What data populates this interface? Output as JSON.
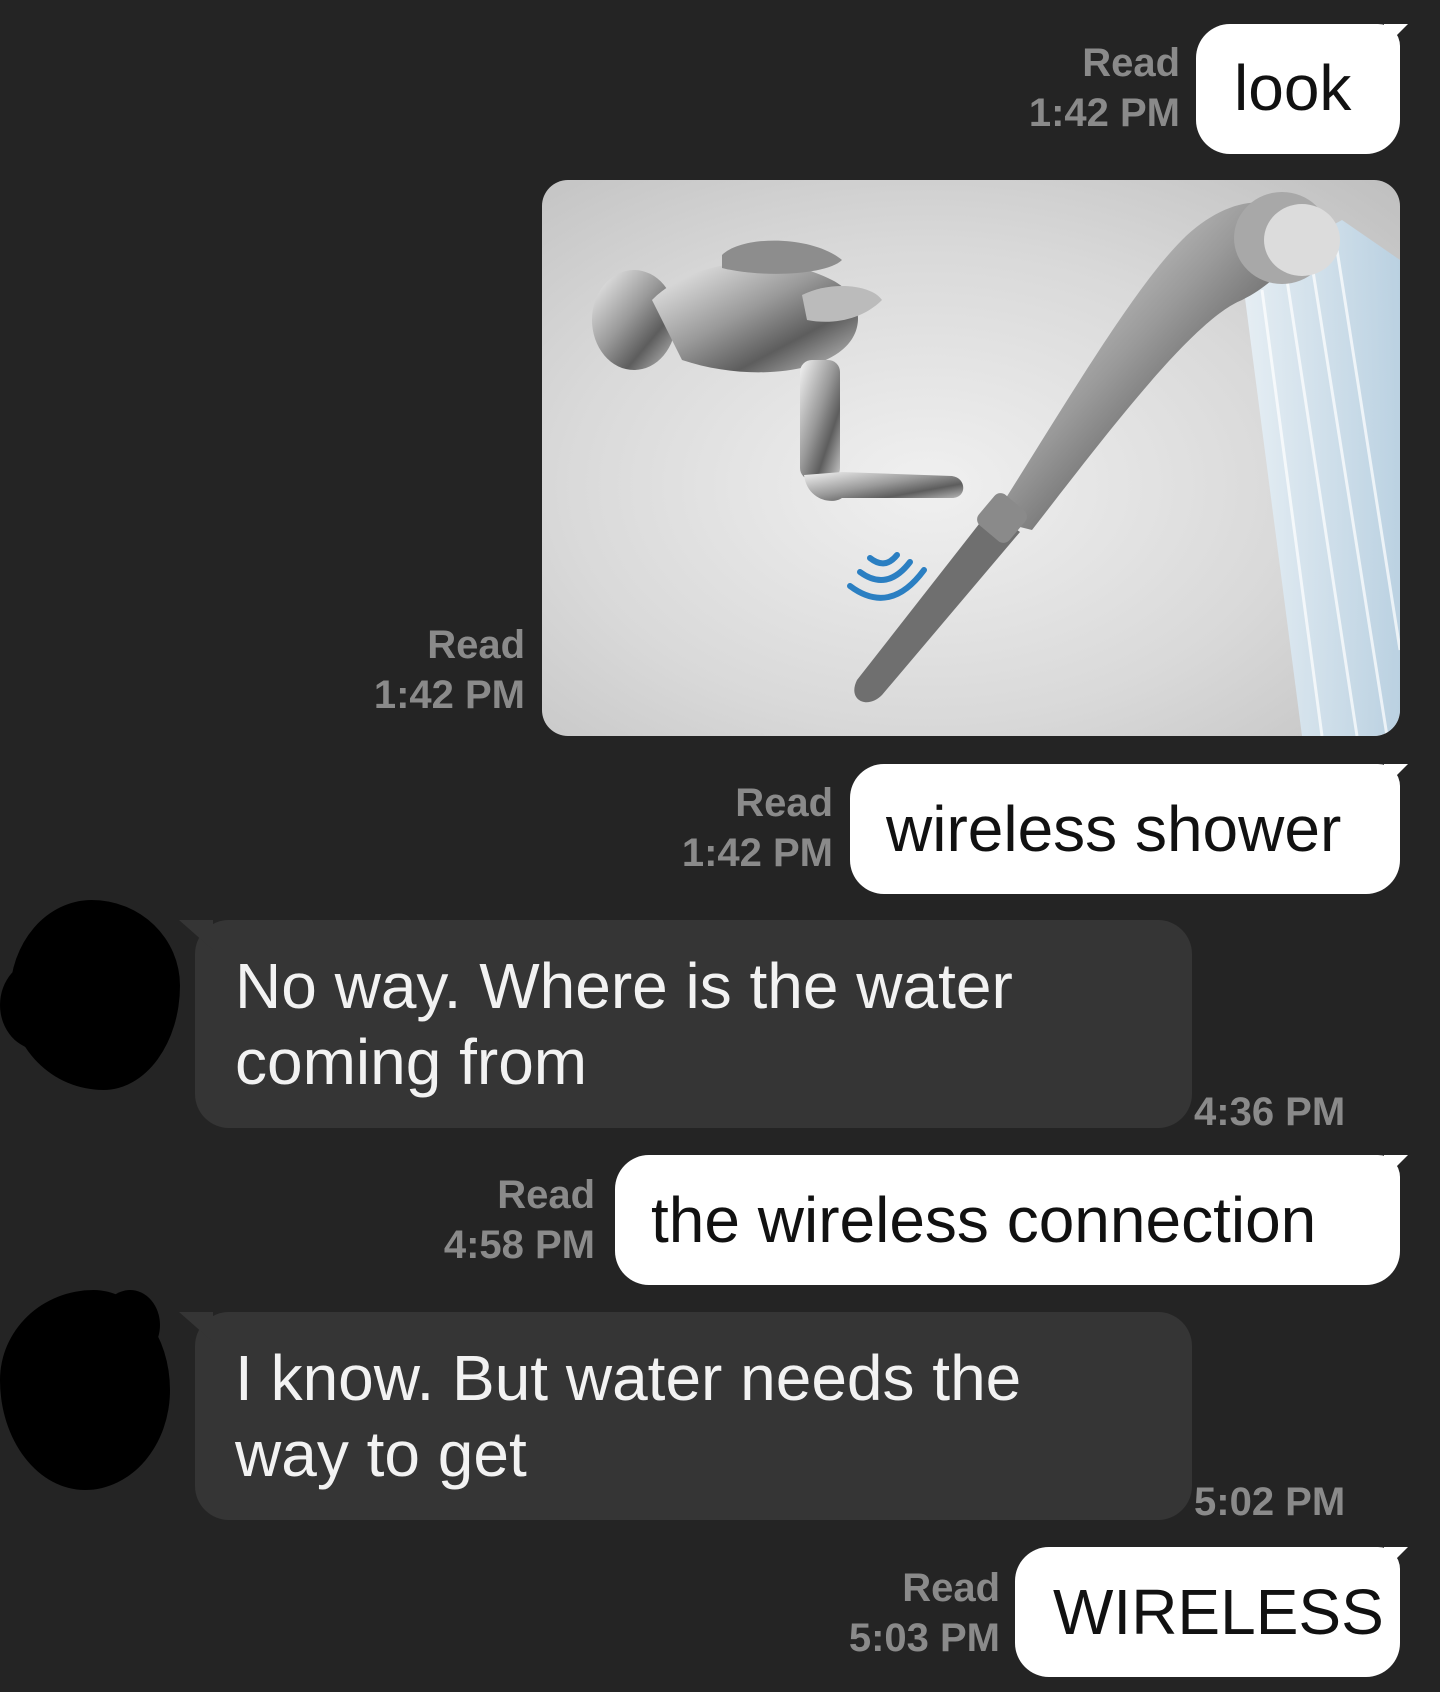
{
  "messages": [
    {
      "direction": "out",
      "text": "look",
      "status": "Read",
      "time": "1:42 PM"
    },
    {
      "direction": "out",
      "type": "image",
      "image_icon": "wireless-shower-photo",
      "status": "Read",
      "time": "1:42 PM"
    },
    {
      "direction": "out",
      "text": "wireless shower",
      "status": "Read",
      "time": "1:42 PM"
    },
    {
      "direction": "in",
      "lines": [
        "No way. Where is the water",
        "coming from"
      ],
      "time": "4:36 PM"
    },
    {
      "direction": "out",
      "text": "the wireless connection",
      "status": "Read",
      "time": "4:58 PM"
    },
    {
      "direction": "in",
      "lines": [
        "I know. But water needs the",
        "way to get"
      ],
      "time": "5:02 PM"
    },
    {
      "direction": "out",
      "text": "WIRELESS",
      "status": "Read",
      "time": "5:03 PM"
    }
  ],
  "colors": {
    "background": "#242424",
    "sent_bubble": "#ffffff",
    "received_bubble": "#353535",
    "meta_text": "#8a8a8a",
    "avatar_redaction": "#000000"
  }
}
